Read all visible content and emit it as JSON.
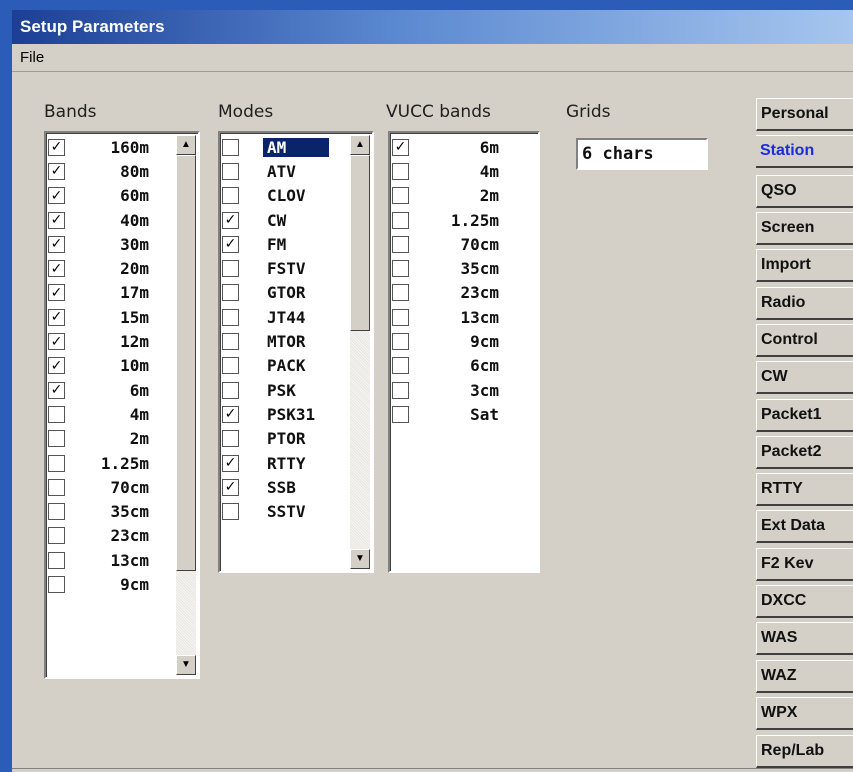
{
  "window": {
    "title": "Setup Parameters"
  },
  "menu": {
    "file_label": "File"
  },
  "bands": {
    "label": "Bands",
    "items": [
      {
        "label": "160m",
        "checked": true
      },
      {
        "label": "80m",
        "checked": true
      },
      {
        "label": "60m",
        "checked": true
      },
      {
        "label": "40m",
        "checked": true
      },
      {
        "label": "30m",
        "checked": true
      },
      {
        "label": "20m",
        "checked": true
      },
      {
        "label": "17m",
        "checked": true
      },
      {
        "label": "15m",
        "checked": true
      },
      {
        "label": "12m",
        "checked": true
      },
      {
        "label": "10m",
        "checked": true
      },
      {
        "label": "6m",
        "checked": true
      },
      {
        "label": "4m",
        "checked": false
      },
      {
        "label": "2m",
        "checked": false
      },
      {
        "label": "1.25m",
        "checked": false
      },
      {
        "label": "70cm",
        "checked": false
      },
      {
        "label": "35cm",
        "checked": false
      },
      {
        "label": "23cm",
        "checked": false
      },
      {
        "label": "13cm",
        "checked": false
      },
      {
        "label": "9cm",
        "checked": false
      }
    ]
  },
  "modes": {
    "label": "Modes",
    "items": [
      {
        "label": "AM",
        "checked": false,
        "selected": true
      },
      {
        "label": "ATV",
        "checked": false
      },
      {
        "label": "CLOV",
        "checked": false
      },
      {
        "label": "CW",
        "checked": true
      },
      {
        "label": "FM",
        "checked": true
      },
      {
        "label": "FSTV",
        "checked": false
      },
      {
        "label": "GTOR",
        "checked": false
      },
      {
        "label": "JT44",
        "checked": false
      },
      {
        "label": "MTOR",
        "checked": false
      },
      {
        "label": "PACK",
        "checked": false
      },
      {
        "label": "PSK",
        "checked": false
      },
      {
        "label": "PSK31",
        "checked": true
      },
      {
        "label": "PTOR",
        "checked": false
      },
      {
        "label": "RTTY",
        "checked": true
      },
      {
        "label": "SSB",
        "checked": true
      },
      {
        "label": "SSTV",
        "checked": false
      }
    ]
  },
  "vucc": {
    "label": "VUCC bands",
    "items": [
      {
        "label": "6m",
        "checked": true
      },
      {
        "label": "4m",
        "checked": false
      },
      {
        "label": "2m",
        "checked": false
      },
      {
        "label": "1.25m",
        "checked": false
      },
      {
        "label": "70cm",
        "checked": false
      },
      {
        "label": "35cm",
        "checked": false
      },
      {
        "label": "23cm",
        "checked": false
      },
      {
        "label": "13cm",
        "checked": false
      },
      {
        "label": "9cm",
        "checked": false
      },
      {
        "label": "6cm",
        "checked": false
      },
      {
        "label": "3cm",
        "checked": false
      },
      {
        "label": "Sat",
        "checked": false
      }
    ]
  },
  "grids": {
    "label": "Grids",
    "value": "6 chars"
  },
  "tabs": [
    {
      "label": "Personal"
    },
    {
      "label": "Station",
      "active": true
    },
    {
      "label": "QSO"
    },
    {
      "label": "Screen"
    },
    {
      "label": "Import"
    },
    {
      "label": "Radio"
    },
    {
      "label": "Control"
    },
    {
      "label": "CW"
    },
    {
      "label": "Packet1"
    },
    {
      "label": "Packet2"
    },
    {
      "label": "RTTY"
    },
    {
      "label": "Ext Data"
    },
    {
      "label": "F2 Kev"
    },
    {
      "label": "DXCC"
    },
    {
      "label": "WAS"
    },
    {
      "label": "WAZ"
    },
    {
      "label": "WPX"
    },
    {
      "label": "Rep/Lab"
    }
  ],
  "icons": {
    "check": "✓",
    "scroll_up": "▲",
    "scroll_down": "▼"
  }
}
